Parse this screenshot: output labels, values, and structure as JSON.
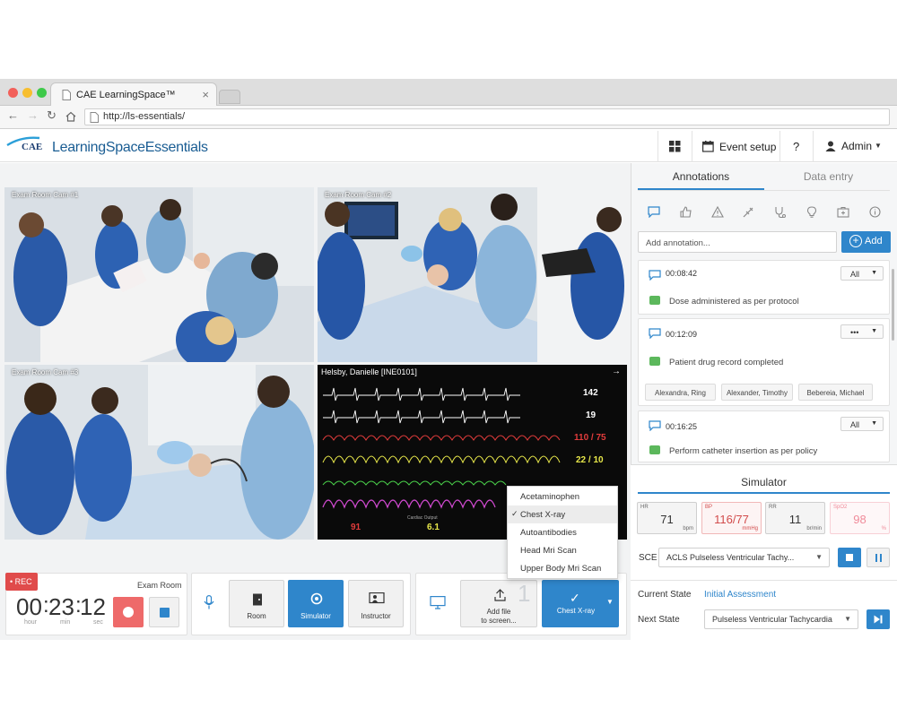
{
  "browser": {
    "tab_title": "CAE LearningSpace™",
    "url": "http://ls-essentials/"
  },
  "header": {
    "logo_brand": "CAE",
    "logo_product": "LearningSpace",
    "logo_product_bold": "Essentials",
    "event_setup": "Event setup",
    "help": "?",
    "user": "Admin"
  },
  "cameras": [
    {
      "label": "Exam Room Cam #1"
    },
    {
      "label": "Exam Room Cam #2"
    },
    {
      "label": "Exam Room Cam #3"
    }
  ],
  "monitor": {
    "patient": "Helsby, Danielle [INE0101]",
    "vitals": [
      {
        "name": "HR",
        "value": "142",
        "color": "#ffffff"
      },
      {
        "name": "UA",
        "value": "19",
        "color": "#ffffff"
      },
      {
        "name": "ABP",
        "value": "110 / 75",
        "color": "#e23c3c"
      },
      {
        "name": "PAP",
        "value": "22 / 10",
        "color": "#e8e84a"
      },
      {
        "name": "CVP",
        "value": "",
        "color": "#4ad14a"
      },
      {
        "name": "PLETH",
        "value": "",
        "color": "#d14ad1"
      }
    ],
    "bottom_values": [
      "91",
      "6.1"
    ],
    "bottom_labels": [
      "Cardiac Output"
    ]
  },
  "dropdown": {
    "items": [
      "Acetaminophen",
      "Chest X-ray",
      "Autoantibodies",
      "Head Mri Scan",
      "Upper Body  Mri Scan"
    ],
    "selected": "Chest X-ray"
  },
  "recorder": {
    "rec_label": "• REC",
    "room": "Exam Room",
    "hours": "00",
    "minutes": "23",
    "seconds": "12",
    "hours_unit": "hour",
    "minutes_unit": "min",
    "seconds_unit": "sec"
  },
  "sources": {
    "room": "Room",
    "simulator": "Simulator",
    "instructor": "Instructor"
  },
  "media": {
    "add_file": "Add file",
    "add_file_2": "to screen...",
    "counter": "1",
    "current": "Chest X-ray"
  },
  "annotations_panel": {
    "tab_annotations": "Annotations",
    "tab_data_entry": "Data entry",
    "input_placeholder": "Add annotation...",
    "add_button": "Add",
    "entries": [
      {
        "time": "00:08:42",
        "filter": "All",
        "text": "Dose administered as per protocol"
      },
      {
        "time": "00:12:09",
        "filter": "•••",
        "text": "Patient drug record completed",
        "tags": [
          "Alexandra, Ring",
          "Alexander, Timothy",
          "Bebereia, Michael"
        ]
      },
      {
        "time": "00:16:25",
        "filter": "All",
        "text": "Perform catheter insertion as per policy"
      }
    ]
  },
  "simulator": {
    "title": "Simulator",
    "vitals": [
      {
        "label": "HR",
        "value": "71",
        "unit": "bpm"
      },
      {
        "label": "BP",
        "value": "116/77",
        "unit": "mmHg"
      },
      {
        "label": "RR",
        "value": "11",
        "unit": "br/min"
      },
      {
        "label": "SpO2",
        "value": "98",
        "unit": "%"
      }
    ],
    "sce_label": "SCE",
    "sce_value": "ACLS Pulseless Ventricular Tachy...",
    "current_state_label": "Current State",
    "current_state_value": "Initial Assessment",
    "next_state_label": "Next State",
    "next_state_value": "Pulseless Ventricular Tachycardia"
  },
  "colors": {
    "accent": "#2f86cb",
    "record": "#e04b4b",
    "annotation_green": "#5cb85c"
  }
}
